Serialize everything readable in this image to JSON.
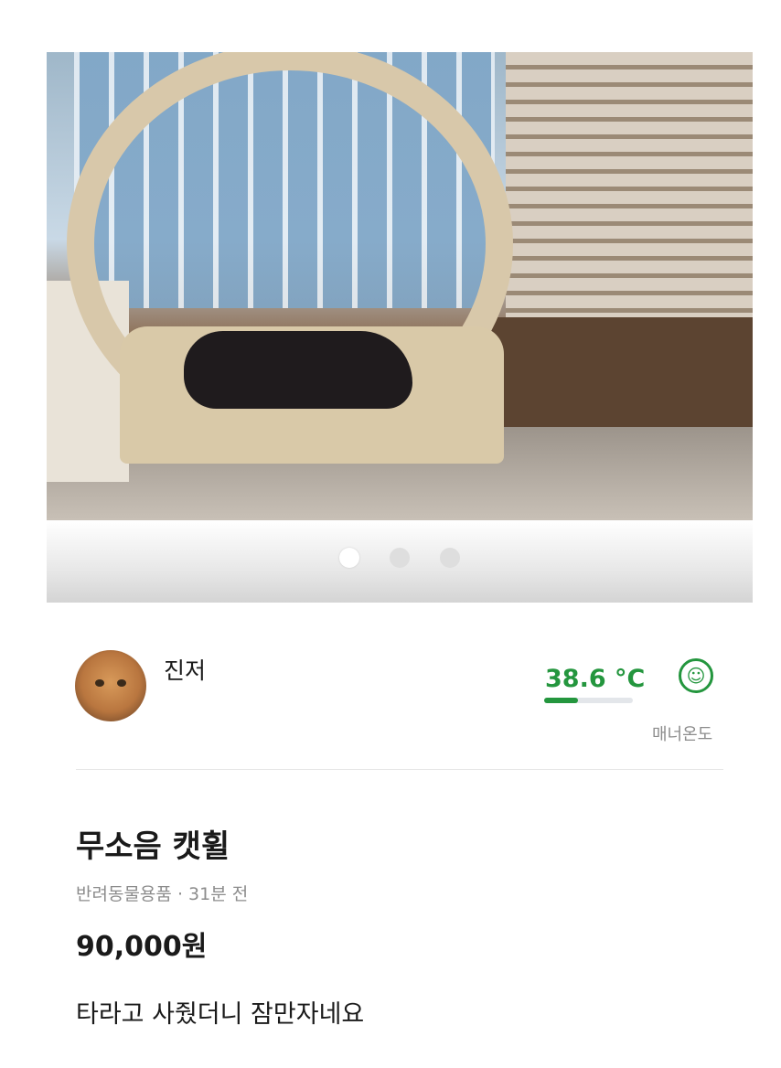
{
  "listing": {
    "image": {
      "description_icon": "product-photo",
      "carousel_count": 3,
      "active_index": 0
    },
    "seller": {
      "name": "진저",
      "temperature": "38.6 °C",
      "temperature_value": 38.6,
      "temperature_bar_fraction": 0.386,
      "temperature_label": "매너온도",
      "temperature_color": "#24963e",
      "face_icon": "smile-face-icon"
    },
    "title": "무소음 캣휠",
    "category": "반려동물용품",
    "separator": "·",
    "time_ago": "31분 전",
    "price": "90,000원",
    "description": "타라고 사줬더니 잠만자네요"
  }
}
